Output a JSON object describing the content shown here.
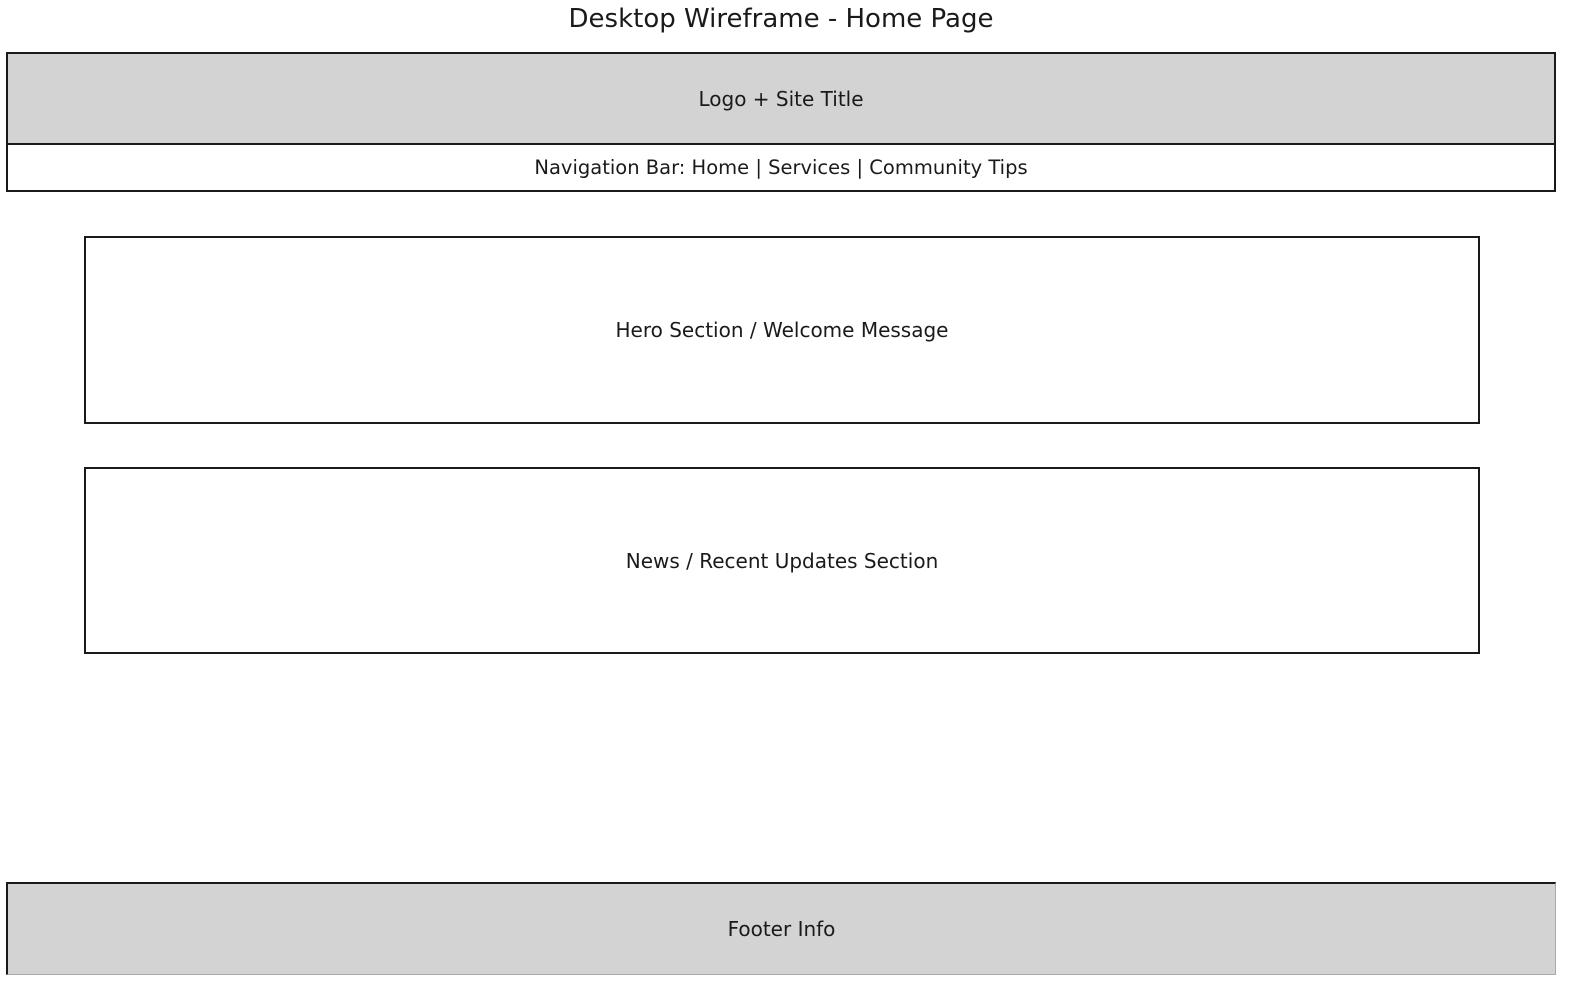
{
  "title": "Desktop Wireframe - Home Page",
  "header": {
    "label": "Logo + Site Title"
  },
  "nav": {
    "label": "Navigation Bar: Home | Services | Community Tips"
  },
  "hero": {
    "label": "Hero Section / Welcome Message"
  },
  "news": {
    "label": "News / Recent Updates Section"
  },
  "footer": {
    "label": "Footer Info"
  },
  "colors": {
    "header_fill": "#d3d3d3",
    "footer_fill": "#d3d3d3",
    "border": "#1a1a1a"
  }
}
